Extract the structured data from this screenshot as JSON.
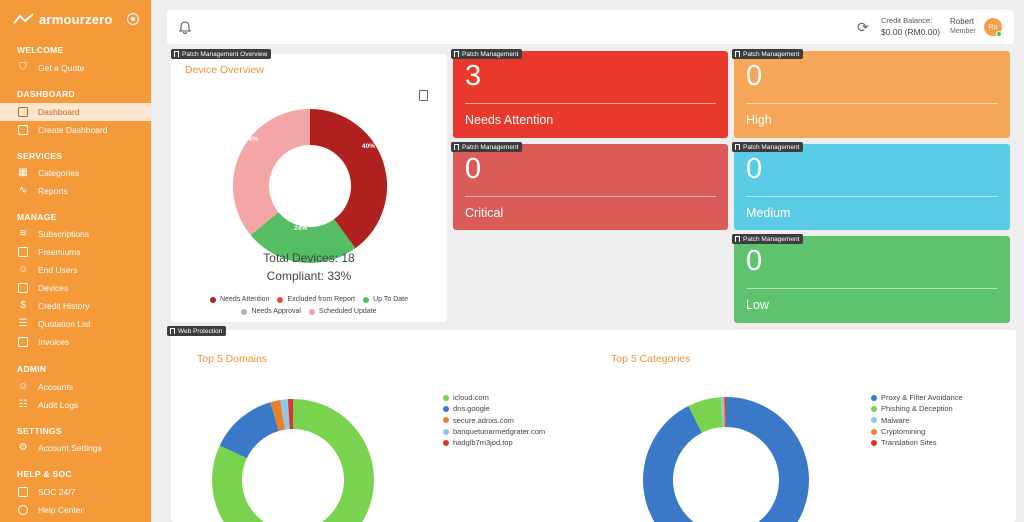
{
  "brand": {
    "name": "armourzero"
  },
  "sidebar": {
    "sections": [
      {
        "title": "WELCOME",
        "items": [
          {
            "label": "Get a Quote",
            "icon": "shield-icon"
          }
        ]
      },
      {
        "title": "DASHBOARD",
        "items": [
          {
            "label": "Dashboard",
            "icon": "dashboard-icon",
            "active": true
          },
          {
            "label": "Create Dashboard",
            "icon": "create-dashboard-icon"
          }
        ]
      },
      {
        "title": "SERVICES",
        "items": [
          {
            "label": "Categories",
            "icon": "grid-icon"
          },
          {
            "label": "Reports",
            "icon": "activity-icon"
          }
        ]
      },
      {
        "title": "MANAGE",
        "items": [
          {
            "label": "Subscriptions",
            "icon": "layers-icon"
          },
          {
            "label": "Freemiums",
            "icon": "gift-icon"
          },
          {
            "label": "End Users",
            "icon": "users-icon"
          },
          {
            "label": "Devices",
            "icon": "devices-icon"
          },
          {
            "label": "Credit History",
            "icon": "dollar-icon"
          },
          {
            "label": "Quotation List",
            "icon": "list-icon"
          },
          {
            "label": "Invoices",
            "icon": "invoice-icon"
          }
        ]
      },
      {
        "title": "ADMIN",
        "items": [
          {
            "label": "Accounts",
            "icon": "accounts-icon"
          },
          {
            "label": "Audit Logs",
            "icon": "audit-icon"
          }
        ]
      },
      {
        "title": "SETTINGS",
        "items": [
          {
            "label": "Account Settings",
            "icon": "gear-icon"
          }
        ]
      },
      {
        "title": "HELP & SOC",
        "items": [
          {
            "label": "SOC 24/7",
            "icon": "chat-icon"
          },
          {
            "label": "Help Center",
            "icon": "help-icon"
          }
        ]
      }
    ]
  },
  "topbar": {
    "credit_label": "Credit Balance:",
    "credit_value": "$0.00 (RM0.00)",
    "user_name": "Robert",
    "user_role": "Member",
    "avatar_initials": "Ro"
  },
  "tags": {
    "overview": "Patch Management Overview",
    "patch": "Patch Management",
    "web": "Web Protection"
  },
  "device_overview": {
    "title": "Device Overview",
    "total_text": "Total Devices: 18",
    "compliant_text": "Compliant: 33%",
    "slice_labels": [
      "40%",
      "24%",
      "36%"
    ],
    "legend": [
      {
        "label": "Needs Attention",
        "color": "#b0201e"
      },
      {
        "label": "Excluded from Report",
        "color": "#e74a3b"
      },
      {
        "label": "Up To Date",
        "color": "#55be64"
      },
      {
        "label": "Needs Approval",
        "color": "#b5b5b5"
      },
      {
        "label": "Scheduled Update",
        "color": "#f4a5a5"
      }
    ]
  },
  "stats": [
    {
      "value": "3",
      "label": "Needs Attention",
      "color": "#e8392c"
    },
    {
      "value": "0",
      "label": "High",
      "color": "#f5a658"
    },
    {
      "value": "0",
      "label": "Critical",
      "color": "#da5b57"
    },
    {
      "value": "0",
      "label": "Medium",
      "color": "#5acbe5"
    },
    {
      "value": "0",
      "label": "Low",
      "color": "#5ec26f"
    }
  ],
  "web_protection": {
    "domains_title": "Top 5 Domains",
    "categories_title": "Top 5 Categories",
    "domains_legend": [
      {
        "label": "icloud.com",
        "color": "#7ad34e"
      },
      {
        "label": "dns.google",
        "color": "#3a78c8"
      },
      {
        "label": "secure.adnxs.com",
        "color": "#e9822a"
      },
      {
        "label": "banquetunarmedgrater.com",
        "color": "#8fc8e8"
      },
      {
        "label": "hadglb7m3jod.top",
        "color": "#d9352c"
      }
    ],
    "categories_legend": [
      {
        "label": "Proxy & Filter Avoidance",
        "color": "#3a78c8"
      },
      {
        "label": "Phishing & Deception",
        "color": "#7ad34e"
      },
      {
        "label": "Malware",
        "color": "#8fc8e8"
      },
      {
        "label": "Cryptomining",
        "color": "#e9822a"
      },
      {
        "label": "Translation Sites",
        "color": "#d9352c"
      }
    ]
  },
  "chart_data": [
    {
      "type": "pie",
      "title": "Device Overview",
      "categories": [
        "Needs Attention",
        "Excluded from Report",
        "Up To Date",
        "Needs Approval",
        "Scheduled Update"
      ],
      "values": [
        40,
        0,
        24,
        0,
        36
      ],
      "colors": [
        "#b0201e",
        "#e74a3b",
        "#55be64",
        "#b5b5b5",
        "#f4a5a5"
      ]
    },
    {
      "type": "pie",
      "title": "Top 5 Domains",
      "categories": [
        "icloud.com",
        "dns.google",
        "secure.adnxs.com",
        "banquetunarmedgrater.com",
        "hadglb7m3jod.top"
      ],
      "values": [
        82,
        13.5,
        2,
        1.5,
        1
      ],
      "colors": [
        "#7ad34e",
        "#3a78c8",
        "#e9822a",
        "#8fc8e8",
        "#d9352c"
      ]
    },
    {
      "type": "pie",
      "title": "Top 5 Categories",
      "categories": [
        "Proxy & Filter Avoidance",
        "Phishing & Deception",
        "Malware",
        "Cryptomining",
        "Translation Sites"
      ],
      "values": [
        92.5,
        6.5,
        0.5,
        0.3,
        0.2
      ],
      "colors": [
        "#3a78c8",
        "#7ad34e",
        "#8fc8e8",
        "#e9822a",
        "#d9352c"
      ]
    }
  ]
}
